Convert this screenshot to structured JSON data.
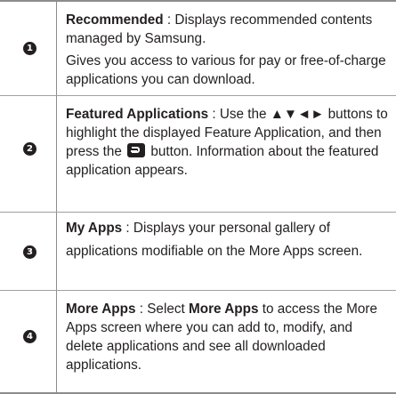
{
  "rows": [
    {
      "number": "1",
      "title": "Recommended",
      "text1": " : Displays recommended contents managed by Samsung.",
      "text2": "Gives you access to various for pay or free-of-charge applications you can download."
    },
    {
      "number": "2",
      "title": "Featured Applications",
      "text1": " : Use the ",
      "arrows": "▲▼◄►",
      "text2": " buttons to highlight the displayed Feature Application, and then press the ",
      "button_icon": "enter-button-icon",
      "text3": " button. Information about the featured application appears."
    },
    {
      "number": "3",
      "title": "My Apps",
      "text1": " : Displays your personal gallery of applications modifiable on the More Apps screen."
    },
    {
      "number": "4",
      "title": "More Apps",
      "text1": " : Select ",
      "title_again": "More Apps",
      "text2": " to access the More Apps screen where you can add to, modify, and delete applications and see all downloaded applications."
    }
  ]
}
